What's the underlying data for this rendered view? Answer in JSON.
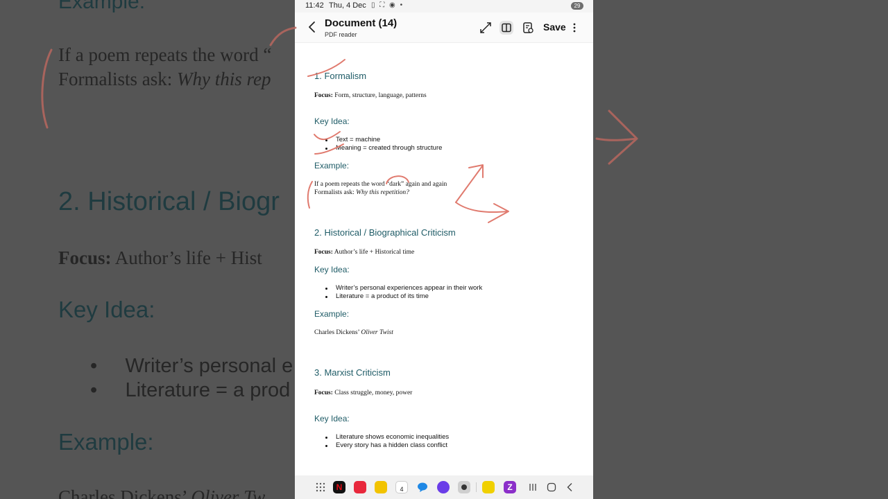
{
  "status": {
    "time": "11:42",
    "date": "Thu, 4 Dec",
    "battery": "29"
  },
  "appbar": {
    "title": "Document (14)",
    "subtitle": "PDF reader",
    "save_label": "Save"
  },
  "document": {
    "s1": {
      "heading": "1. Formalism",
      "focus_label": "Focus:",
      "focus_text": "Form, structure, language, patterns",
      "key_idea_label": "Key Idea:",
      "bullets": [
        "Text = machine",
        "Meaning = created through structure"
      ],
      "example_label": "Example:",
      "example_line1": "If a poem repeats the word “dark” again and again",
      "example_line2_prefix": "Formalists ask: ",
      "example_line2_italic": "Why this repetition?"
    },
    "s2": {
      "heading": "2. Historical / Biographical Criticism",
      "focus_label": "Focus:",
      "focus_text": "Author’s life + Historical time",
      "key_idea_label": "Key Idea:",
      "bullets": [
        "Writer’s personal experiences appear in their work",
        "Literature = a product of its time"
      ],
      "example_label": "Example:",
      "example_prefix": "Charles Dickens’ ",
      "example_italic": "Oliver Twist"
    },
    "s3": {
      "heading": "3. Marxist Criticism",
      "focus_label": "Focus:",
      "focus_text": "Class struggle, money, power",
      "key_idea_label": "Key Idea:",
      "bullets": [
        "Literature shows economic inequalities",
        "Every story has a hidden class conflict"
      ]
    }
  },
  "background": {
    "example": "Example:",
    "line1": "If a poem repeats the word “",
    "line2_prefix": "Formalists ask: ",
    "line2_italic": "Why this rep",
    "heading2": "2. Historical / Biogr",
    "focus_label": "Focus:",
    "focus_text": "Author’s life + Hist",
    "key_idea": "Key Idea:",
    "bullet1": "Writer’s personal e",
    "bullet2": "Literature = a prod",
    "example2": "Example:",
    "dickens_prefix": "Charles Dickens’ ",
    "dickens_italic": "Oliver Tw"
  },
  "dock": {
    "calendar_day": "4",
    "apps": [
      {
        "name": "netflix",
        "color": "#111111"
      },
      {
        "name": "notes",
        "color": "#e8283c"
      },
      {
        "name": "folder",
        "color": "#f2c300"
      },
      {
        "name": "calendar",
        "color": "#ffffff"
      },
      {
        "name": "messages",
        "color": "#1e88e5"
      },
      {
        "name": "browser",
        "color": "#6a3de8"
      },
      {
        "name": "camera",
        "color": "#cfcfcf"
      },
      {
        "name": "talabat",
        "color": "#f0d000"
      },
      {
        "name": "zapp",
        "color": "#8b2fc9"
      }
    ]
  },
  "colors": {
    "heading": "#1e5b66",
    "ink": "#e07a6e"
  }
}
